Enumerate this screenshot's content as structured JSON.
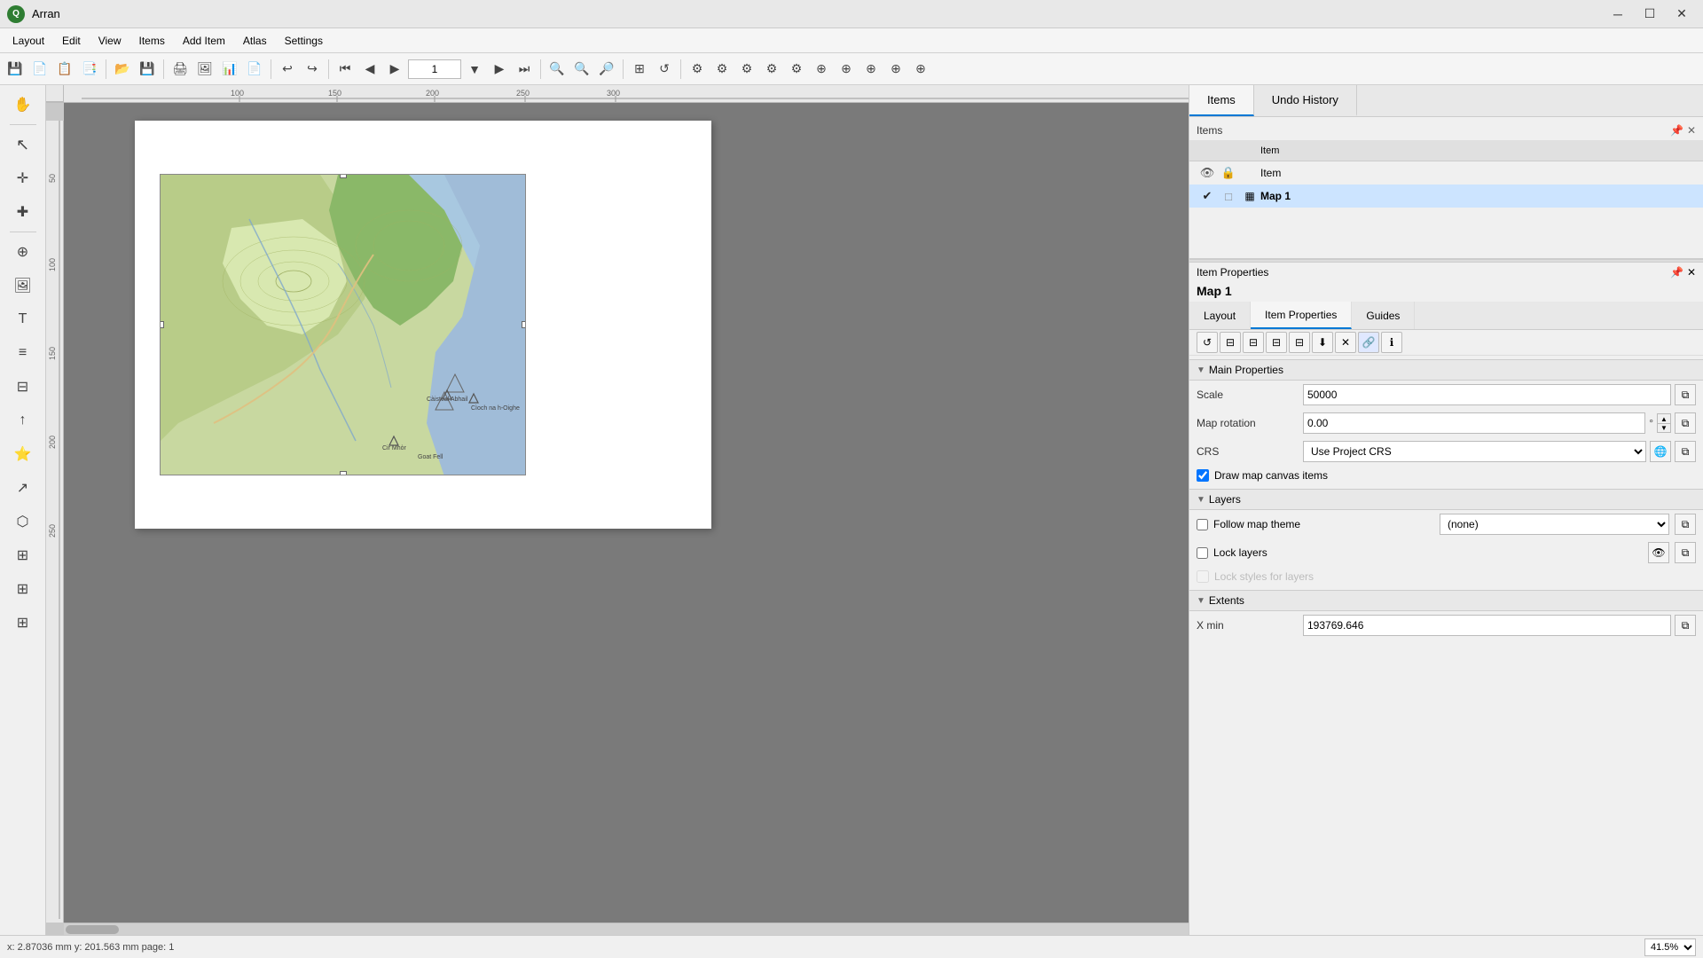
{
  "app": {
    "title": "Arran",
    "logo": "Q"
  },
  "window_controls": {
    "minimize": "─",
    "maximize": "☐",
    "close": "✕"
  },
  "menubar": {
    "items": [
      "Layout",
      "Edit",
      "View",
      "Items",
      "Add Item",
      "Atlas",
      "Settings"
    ]
  },
  "panel_tabs": {
    "items_label": "Items",
    "undo_label": "Undo History"
  },
  "items_panel": {
    "header": "Items",
    "columns": {
      "item_col": "Item"
    },
    "rows": [
      {
        "visible": true,
        "locked": true,
        "icon": "□",
        "name": "Item",
        "selected": false
      },
      {
        "visible": true,
        "locked": false,
        "icon": "▦",
        "name": "Map 1",
        "selected": true
      }
    ]
  },
  "properties": {
    "header": "Item Properties",
    "title": "Map 1",
    "tabs": [
      "Layout",
      "Item Properties",
      "Guides"
    ],
    "active_tab": "Item Properties",
    "toolbar_buttons": [
      "↺",
      "📋",
      "📋",
      "📋",
      "📋",
      "⬇",
      "✕",
      "🔗",
      "ℹ"
    ],
    "sections": {
      "main_properties": {
        "label": "Main Properties",
        "fields": {
          "scale_label": "Scale",
          "scale_value": "50000",
          "map_rotation_label": "Map rotation",
          "map_rotation_value": "0.00",
          "map_rotation_unit": "°",
          "crs_label": "CRS",
          "crs_value": "Use Project CRS",
          "draw_canvas_label": "Draw map canvas items",
          "draw_canvas_checked": true
        }
      },
      "layers": {
        "label": "Layers",
        "follow_map_theme_label": "Follow map theme",
        "follow_map_theme_checked": false,
        "follow_map_theme_value": "(none)",
        "lock_layers_label": "Lock layers",
        "lock_layers_checked": false,
        "lock_styles_label": "Lock styles for layers",
        "lock_styles_checked": false
      },
      "extents": {
        "label": "Extents",
        "x_min_label": "X min",
        "x_min_value": "193769.646"
      }
    }
  },
  "statusbar": {
    "coords": "x: 2.87036 mm y: 201.563 mm page: 1",
    "zoom_value": "41.5%"
  },
  "ruler": {
    "top_ticks": [
      "100",
      "150",
      "200",
      "250",
      "300"
    ],
    "top_positions": [
      290,
      400,
      510,
      615,
      720
    ]
  },
  "icons": {
    "eye": "👁",
    "lock": "🔒",
    "map": "▦",
    "chevron_down": "▼",
    "chevron_right": "▶",
    "refresh": "↺",
    "copy": "⧉",
    "delete": "✕",
    "link": "🔗",
    "info": "ℹ",
    "globe": "🌐",
    "clipboard": "📋"
  }
}
